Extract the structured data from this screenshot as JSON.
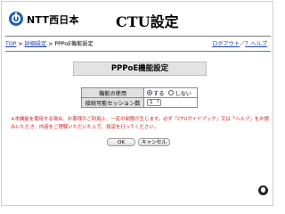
{
  "header": {
    "brand": "NTT西日本",
    "title": "CTU設定"
  },
  "nav": {
    "breadcrumb": [
      {
        "label": "TOP",
        "link": true
      },
      {
        "label": " > ",
        "link": false
      },
      {
        "label": "詳細設定",
        "link": true
      },
      {
        "label": " > PPPoE機能設定",
        "link": false
      }
    ],
    "logout": "ログアウト",
    "separator": "／",
    "help": "？ヘルプ"
  },
  "section": {
    "title": "PPPoE機能設定"
  },
  "settings": {
    "rows": [
      {
        "label": "機能の使用",
        "options": [
          {
            "label": "する",
            "selected": true
          },
          {
            "label": "しない",
            "selected": false
          }
        ]
      },
      {
        "label": "接続可能セッション数",
        "value": "1"
      }
    ]
  },
  "note": "※本機能を使用する場合、お客様のご利用上、一定の制限が生じます。必ず「CTUガイドブック」又は「ヘルプ」をお読みいただき、内容をご理解いただいた上で、設定を行ってください。",
  "buttons": {
    "ok": "OK",
    "cancel": "キャンセル"
  },
  "colors": {
    "link": "#1d3fb0",
    "note": "#d11b1b",
    "section_bg": "#e3e3e3",
    "logo": "#1f5fb4"
  }
}
